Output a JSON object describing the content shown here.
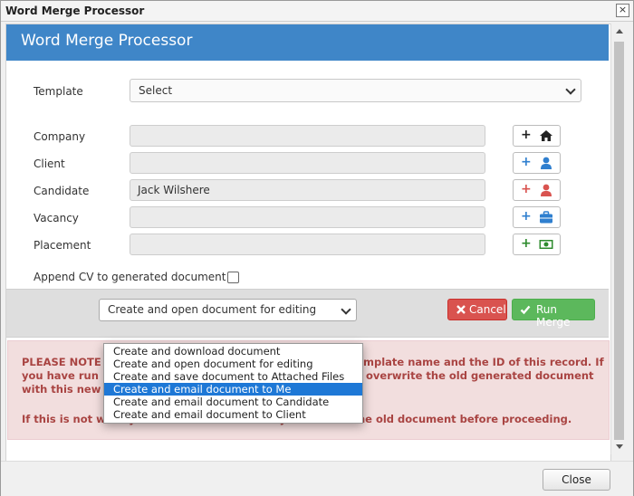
{
  "window": {
    "title": "Word Merge Processor",
    "close_glyph": "×"
  },
  "header": {
    "title": "Word Merge Processor"
  },
  "template": {
    "label": "Template",
    "selected": "Select"
  },
  "fields": [
    {
      "label": "Company",
      "value": "",
      "icon": "home-icon",
      "color": "#222222"
    },
    {
      "label": "Client",
      "value": "",
      "icon": "user-icon",
      "color": "#2f7fcf"
    },
    {
      "label": "Candidate",
      "value": "Jack Wilshere",
      "icon": "user-icon",
      "color": "#d9534f"
    },
    {
      "label": "Vacancy",
      "value": "",
      "icon": "briefcase-icon",
      "color": "#2f7fcf"
    },
    {
      "label": "Placement",
      "value": "",
      "icon": "money-icon",
      "color": "#2e8b2e"
    }
  ],
  "plus_glyph": "+",
  "append_cv": {
    "label": "Append CV to generated document",
    "checked": false
  },
  "merge_mode": {
    "selected": "Create and open document for editing",
    "options": [
      "Create and download document",
      "Create and open document for editing",
      "Create and save document to Attached Files",
      "Create and email document to Me",
      "Create and email document to Candidate",
      "Create and email document to Client"
    ],
    "highlighted_index": 3
  },
  "buttons": {
    "cancel": "Cancel",
    "run": "Run Merge",
    "close": "Close"
  },
  "notice": {
    "line1a": "PLEASE NOTE",
    "line1b": "mplate name and the ID of this record. If",
    "line2a": "you have run",
    "line2b": "overwrite the old generated document",
    "line3": "with this new",
    "line4": "If this is not what you want we recommend you rename the old document before proceeding."
  },
  "colors": {
    "header": "#3f86c8",
    "cancel": "#d9534f",
    "run": "#5cb85c",
    "notice_text": "#a94442",
    "notice_bg": "#f2dede"
  }
}
